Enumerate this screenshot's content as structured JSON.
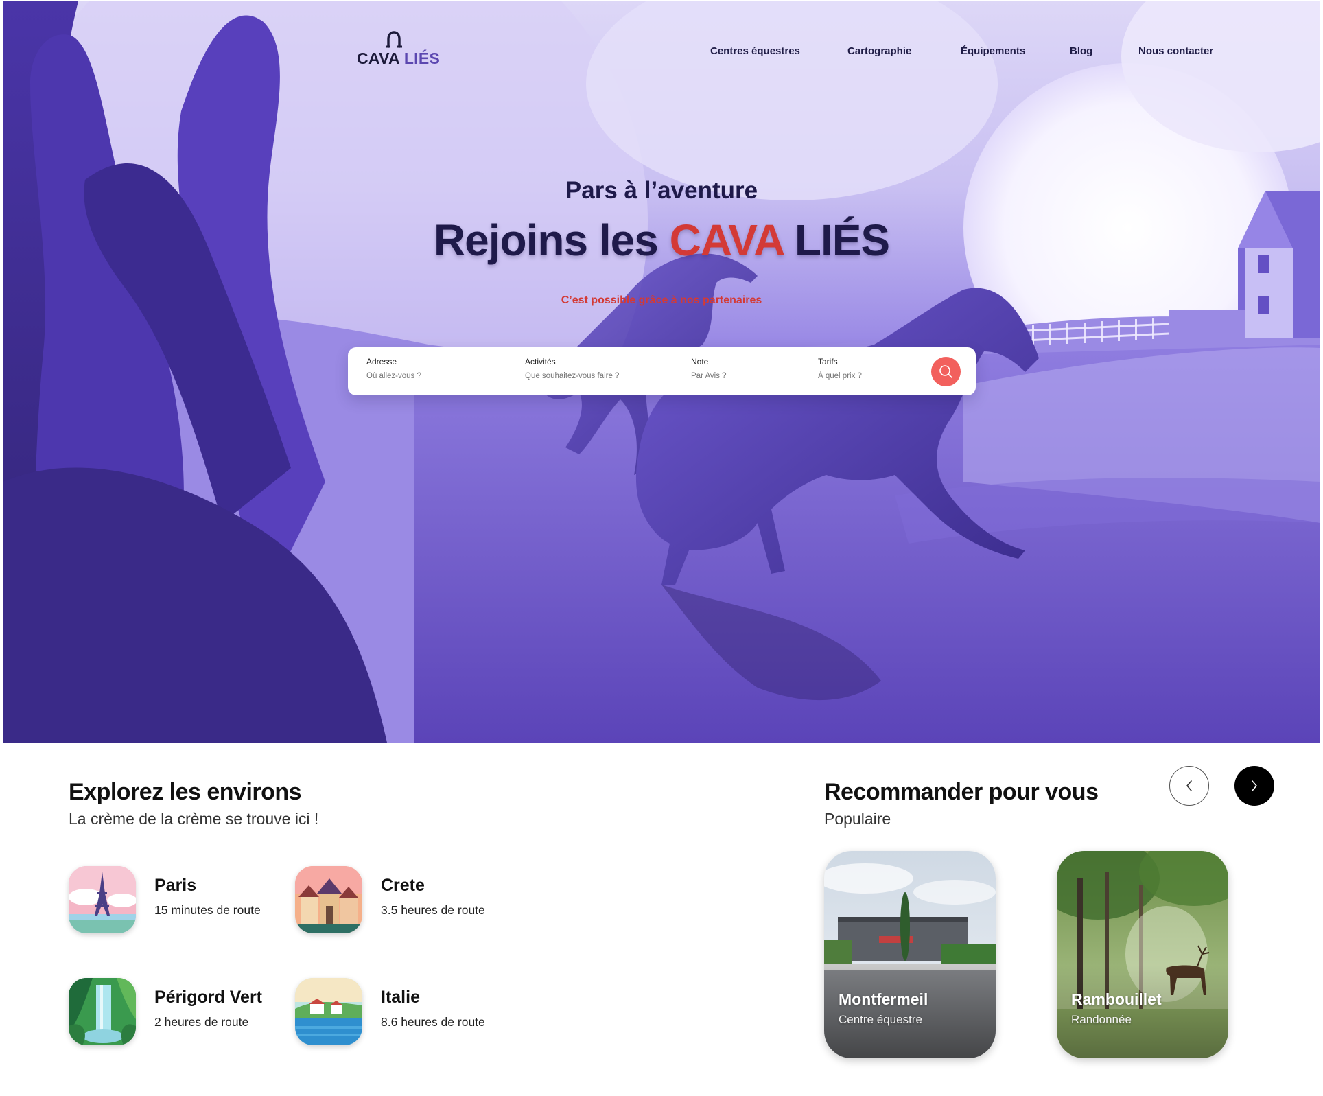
{
  "brand": {
    "name_part1": "CAVA",
    "name_part2": "LIÉS"
  },
  "nav": {
    "items": [
      "Centres équestres",
      "Cartographie",
      "Équipements",
      "Blog",
      "Nous contacter"
    ]
  },
  "hero": {
    "kicker": "Pars à l’aventure",
    "headline_part1": "Rejoins les ",
    "headline_part2": "CAVA",
    "headline_part3": " LIÉS",
    "tagline": "C’est possible grâce à nos partenaires"
  },
  "search": {
    "fields": [
      {
        "label": "Adresse",
        "placeholder": "Où allez-vous ?"
      },
      {
        "label": "Activités",
        "placeholder": "Que souhaitez-vous faire ?"
      },
      {
        "label": "Note",
        "placeholder": "Par Avis ?"
      },
      {
        "label": "Tarifs",
        "placeholder": "À quel prix ?"
      }
    ]
  },
  "explore": {
    "title": "Explorez les environs",
    "subtitle": "La crème de la crème se trouve ici !",
    "destinations": [
      {
        "name": "Paris",
        "distance": "15 minutes de route"
      },
      {
        "name": "Crete",
        "distance": "3.5 heures de route"
      },
      {
        "name": "Périgord Vert",
        "distance": "2 heures de route"
      },
      {
        "name": "Italie",
        "distance": "8.6 heures de route"
      }
    ]
  },
  "recommend": {
    "title": "Recommander pour vous",
    "subtitle": "Populaire",
    "cards": [
      {
        "title": "Montfermeil",
        "subtitle": "Centre équestre"
      },
      {
        "title": "Rambouillet",
        "subtitle": "Randonnée"
      }
    ]
  },
  "colors": {
    "brand_purple": "#5b47b0",
    "accent_red": "#d33a36",
    "search_button": "#f2605d",
    "dark_text": "#1f1a4a"
  }
}
